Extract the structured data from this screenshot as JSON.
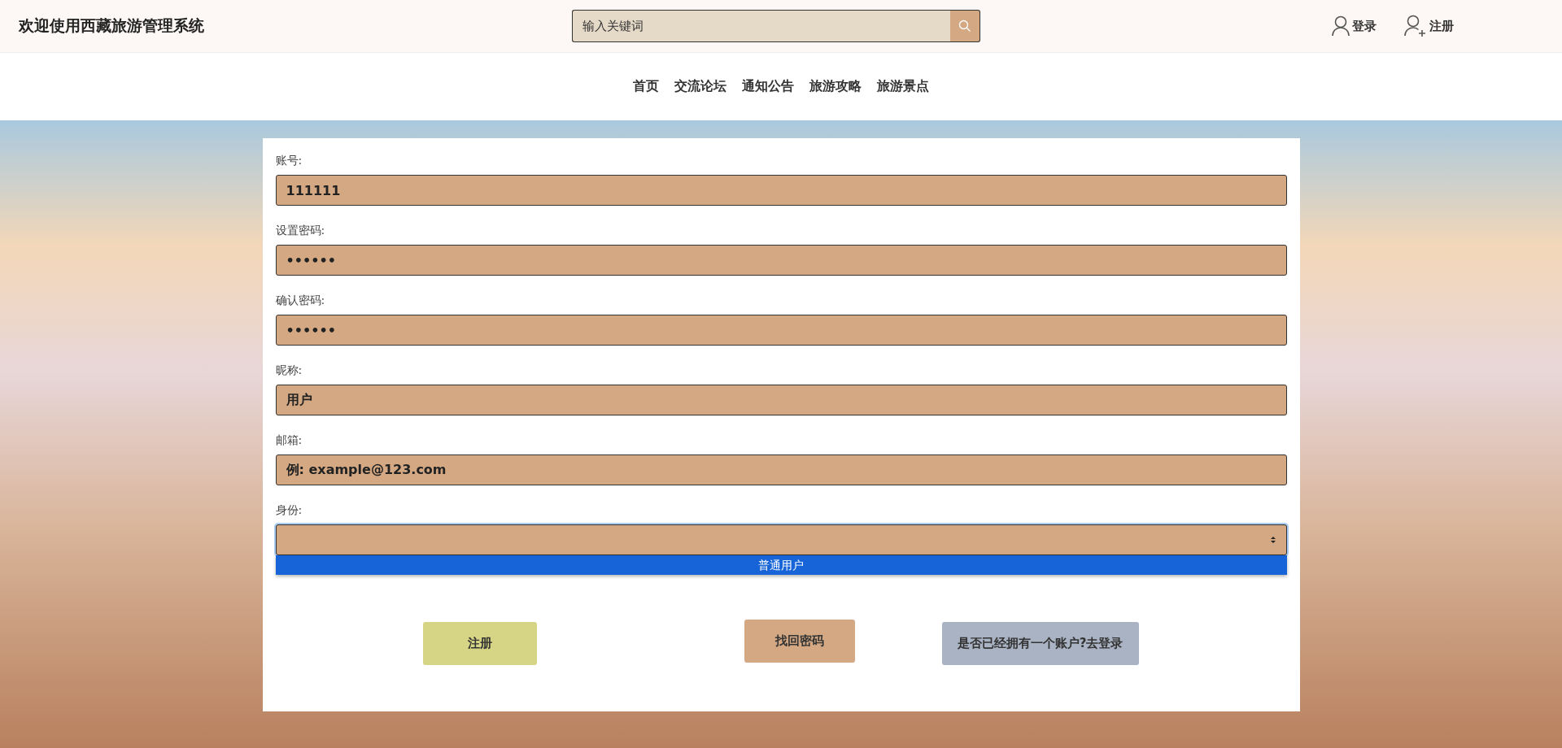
{
  "header": {
    "title": "欢迎使用西藏旅游管理系统",
    "search": {
      "placeholder": "输入关键词"
    },
    "actions": [
      {
        "kind": "login",
        "label": "登录"
      },
      {
        "kind": "register",
        "label": "注册"
      }
    ]
  },
  "nav": [
    {
      "label": "首页"
    },
    {
      "label": "交流论坛"
    },
    {
      "label": "通知公告"
    },
    {
      "label": "旅游攻略"
    },
    {
      "label": "旅游景点"
    }
  ],
  "form": {
    "fields": [
      {
        "label": "账号:",
        "value": "111111"
      },
      {
        "label": "设置密码:",
        "value": "••••••"
      },
      {
        "label": "确认密码:",
        "value": "••••••"
      },
      {
        "label": "昵称:",
        "value": "用户"
      },
      {
        "label": "邮箱:",
        "value": "例: example@123.com"
      }
    ],
    "select": {
      "label": "身份:",
      "expanded": true,
      "options": [
        {
          "label": "普通用户",
          "selected": true
        }
      ]
    },
    "buttons": [
      {
        "kind": "register",
        "label": "注册"
      },
      {
        "kind": "recover",
        "label": "找回密码"
      },
      {
        "kind": "login",
        "label": "是否已经拥有一个账户?去登录"
      }
    ]
  }
}
